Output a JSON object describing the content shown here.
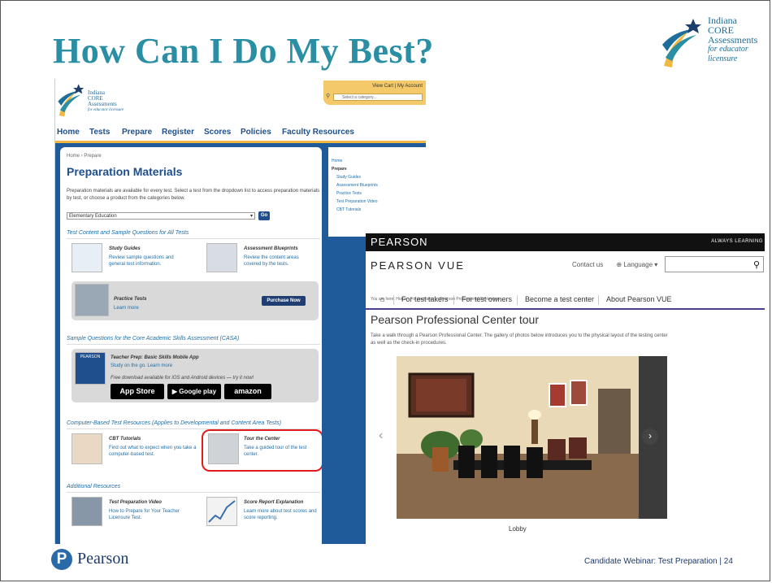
{
  "slide": {
    "title": "How Can I Do My Best?",
    "footer_text": "Candidate Webinar: Test Preparation | 24",
    "footer_logo_text": "Pearson",
    "footer_logo_letter": "P"
  },
  "corner_logo": {
    "line1": "Indiana",
    "line2": "CORE",
    "line3": "Assessments",
    "line4": "for educator licensure"
  },
  "indiana_site": {
    "logo": {
      "line1": "Indiana",
      "line2": "CORE",
      "line3": "Assessments",
      "line4": "for educator licensure"
    },
    "cart_text": "View Cart | My Account",
    "category_select": "Select a category...",
    "nav": [
      "Home",
      "Tests",
      "Prepare",
      "Register",
      "Scores",
      "Policies",
      "Faculty Resources"
    ],
    "breadcrumb": "Home › Prepare",
    "heading": "Preparation Materials",
    "intro": "Preparation materials are available for every test. Select a test from the dropdown list to access preparation materials by test, or choose a product from the categories below.",
    "test_select": "Elementary Education",
    "go_label": "Go",
    "sections": {
      "content": "Test Content and Sample Questions for All Tests",
      "casa": "Sample Questions for the Core Academic Skills Assessment (CASA)",
      "cbt": "Computer-Based Test Resources (Applies to Developmental and Content Area Tests)",
      "additional": "Additional Resources"
    },
    "items": {
      "study_guides_title": "Study Guides",
      "study_guides_desc": "Review sample questions and general test information.",
      "blueprints_title": "Assessment Blueprints",
      "blueprints_desc": "Review the content areas covered by the tests.",
      "practice_title": "Practice Tests",
      "practice_desc": "Learn more",
      "purchase_label": "Purchase Now",
      "app_title": "Teacher Prep: Basic Skills Mobile App",
      "app_desc": "Study on the go. Learn more",
      "app_note": "Free download available for iOS and Android devices — try it now!",
      "app_icon_label": "PEARSON",
      "app_store": "App Store",
      "google_play": "Google play",
      "amazon": "amazon",
      "cbt_title": "CBT Tutorials",
      "cbt_desc": "Find out what to expect when you take a computer-based test.",
      "tour_title": "Tour the Center",
      "tour_desc": "Take a guided tour of the test center.",
      "video_title": "Test Preparation Video",
      "video_desc": "How to Prepare for Your Teacher Licensure Test.",
      "score_title": "Score Report Explanation",
      "score_desc": "Learn more about test scores and score reporting."
    },
    "side_links": [
      "Home",
      "Prepare",
      "Study Guides",
      "Assessment Blueprints",
      "Practice Tests",
      "Test Preparation Video",
      "CBT Tutorials"
    ]
  },
  "pearson_vue": {
    "top_brand": "PEARSON",
    "top_tagline": "ALWAYS LEARNING",
    "logo": "PEARSON VUE",
    "contact": "Contact us",
    "language": "Language",
    "search_placeholder": "",
    "nav": [
      "For test takers",
      "For test owners",
      "Become a test center",
      "About Pearson VUE"
    ],
    "breadcrumb": "You are here: Home › For test takers › Pearson Professional Center tour",
    "heading": "Pearson Professional Center tour",
    "paragraph": "Take a walk through a Pearson Professional Center. The gallery of photos below introduces you to the physical layout of the testing center as well as the check-in procedures.",
    "caption": "Lobby",
    "dot_count": 8,
    "active_dot": 1
  },
  "colors": {
    "title": "#2a8fa4",
    "nav_blue": "#1f4f8c",
    "band": "#1f5b9a",
    "highlight": "#e01b1b"
  }
}
